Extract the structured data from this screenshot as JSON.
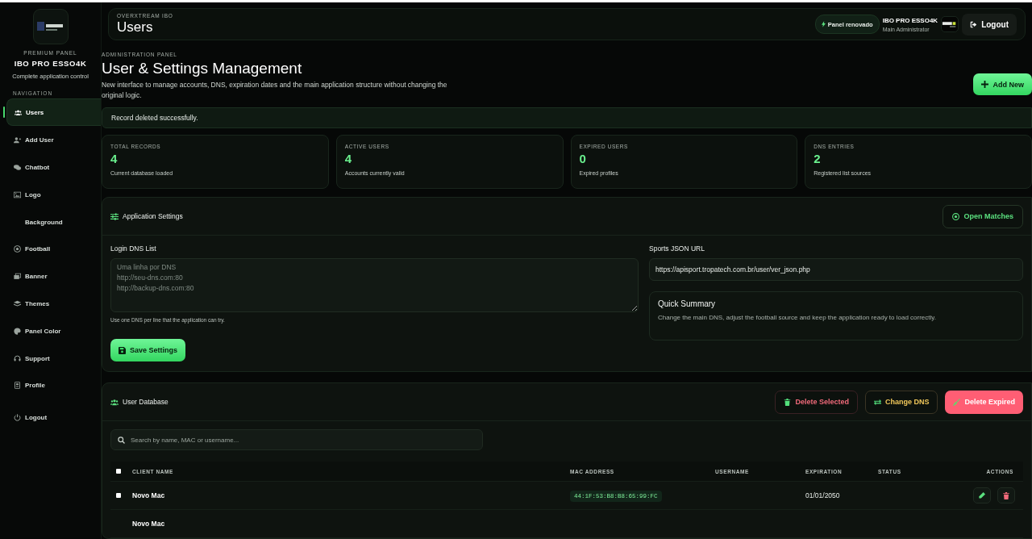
{
  "sidebar": {
    "eyebrow": "PREMIUM PANEL",
    "brand": "IBO PRO ESSO4K",
    "tagline": "Complete application control",
    "section": "NAVIGATION",
    "items": [
      {
        "label": "Users",
        "kind": "users",
        "selected": true
      },
      {
        "label": "Add User",
        "kind": "user-plus",
        "selected": false
      },
      {
        "label": "Chatbot",
        "kind": "chat",
        "selected": false
      },
      {
        "label": "Logo",
        "kind": "image",
        "selected": false
      },
      {
        "label": "Background",
        "kind": "plain",
        "selected": false
      },
      {
        "label": "Football",
        "kind": "ball",
        "selected": false
      },
      {
        "label": "Banner",
        "kind": "banner",
        "selected": false
      },
      {
        "label": "Themes",
        "kind": "layers",
        "selected": false
      },
      {
        "label": "Panel Color",
        "kind": "palette",
        "selected": false
      },
      {
        "label": "Support",
        "kind": "headset",
        "selected": false
      },
      {
        "label": "Profile",
        "kind": "badge",
        "selected": false
      }
    ],
    "logout": "Logout"
  },
  "header": {
    "eyebrow": "OVERXTREAM IBO",
    "title": "Users",
    "badge": "Panel renovado",
    "user_name": "IBO PRO ESSO4K",
    "user_role": "Main Administrator",
    "logout": "Logout"
  },
  "hero": {
    "eyebrow": "ADMINISTRATION PANEL",
    "title": "User & Settings Management",
    "description": "New interface to manage accounts, DNS, expiration dates and the main application structure without changing the original logic.",
    "add_button": "Add New"
  },
  "alert": "Record deleted successfully.",
  "stats": [
    {
      "label": "TOTAL RECORDS",
      "value": "4",
      "caption": "Current database loaded"
    },
    {
      "label": "ACTIVE USERS",
      "value": "4",
      "caption": "Accounts currently valid"
    },
    {
      "label": "EXPIRED USERS",
      "value": "0",
      "caption": "Expired profiles"
    },
    {
      "label": "DNS ENTRIES",
      "value": "2",
      "caption": "Registered list sources"
    }
  ],
  "settings": {
    "title": "Application Settings",
    "open_button": "Open Matches",
    "dns_label": "Login DNS List",
    "dns_placeholder": "Uma linha por DNS\nhttp://seu-dns.com:80\nhttp://backup-dns.com:80",
    "dns_hint": "Use one DNS per line that the application can try.",
    "save_button": "Save Settings",
    "sports_label": "Sports JSON URL",
    "sports_value": "https://apisport.tropatech.com.br/user/ver_json.php",
    "summary_title": "Quick Summary",
    "summary_text": "Change the main DNS, adjust the football source and keep the application ready to load correctly."
  },
  "database": {
    "title": "User Database",
    "buttons": [
      {
        "label": "Delete Selected",
        "kind": "danger-outline"
      },
      {
        "label": "Change DNS",
        "kind": "warning-outline"
      },
      {
        "label": "Delete Expired",
        "kind": "danger"
      }
    ],
    "search_placeholder": "Search by name, MAC or username...",
    "header_checked": false,
    "columns": [
      "CLIENT NAME",
      "MAC ADDRESS",
      "USERNAME",
      "EXPIRATION",
      "STATUS",
      "ACTIONS"
    ],
    "rows": [
      {
        "selected": false,
        "name": "Novo Mac",
        "mac": "44:1F:53:B8:B8:65:99:FC",
        "expiration": "01/01/2050"
      },
      {
        "name": "Novo Mac"
      }
    ]
  }
}
